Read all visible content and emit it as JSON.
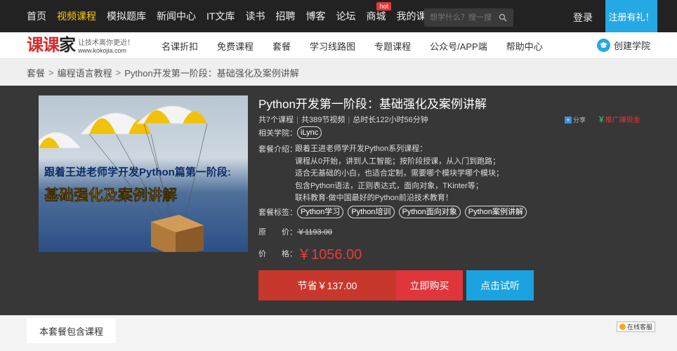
{
  "topnav": {
    "items": [
      "首页",
      "视频课程",
      "模拟题库",
      "新闻中心",
      "IT文库",
      "读书",
      "招聘",
      "博客",
      "论坛",
      "商城",
      "我的课课家"
    ],
    "active_index": 1,
    "hot_badge": "hot",
    "search_placeholder": "想学什么？搜一搜",
    "login": "登录",
    "register": "注册有礼！"
  },
  "subnav": {
    "logo_text_red": "课课",
    "logo_text_dark": "家",
    "slogan": "让技术离你更近！",
    "url": "www.kokojia.com",
    "items": [
      "名课折扣",
      "免费课程",
      "套餐",
      "学习线路图",
      "专题课程",
      "公众号/APP端",
      "帮助中心"
    ],
    "college": "创建学院"
  },
  "breadcrumb": [
    "套餐",
    "编程语言教程",
    "Python开发第一阶段：基础强化及案例讲解"
  ],
  "course": {
    "cover_line1": "跟着王进老师学开发Python篇第一阶段:",
    "cover_line2": "基础强化及案例讲解",
    "title": "Python开发第一阶段：基础强化及案例讲解",
    "meta": {
      "courses": "共7个课程",
      "videos": "共389节视频",
      "duration": "总时长122小时56分钟"
    },
    "share": "分享",
    "promo": "推广赚现金",
    "college_label": "相关学院：",
    "college_tag": "iLync",
    "desc_label": "套餐介绍：",
    "desc_lines": [
      "跟着王进老师学开发Python系列课程：",
      "课程从0开始，讲到人工智能；按阶段授课，从入门到跑路；",
      "适合无基础的小白，也适合定制，需要哪个模块学哪个模块；",
      "包含Python语法，正则表达式，面向对象，TKinter等；",
      "联科教育-做中国最好的Python前沿技术教育！"
    ],
    "tags_label": "套餐标签：",
    "tags": [
      "Python学习",
      "Python培训",
      "Python面向对象",
      "Python案例讲解"
    ],
    "orig_label": "原　　价：",
    "orig_price": "￥1193.00",
    "price_label": "价　　格：",
    "price": "￥1056.00",
    "save_button": "节省￥137.00",
    "buy_button": "立即购买",
    "trial_button": "点击试听"
  },
  "bottom": {
    "tab": "本套餐包含课程",
    "online": "在线客服"
  }
}
